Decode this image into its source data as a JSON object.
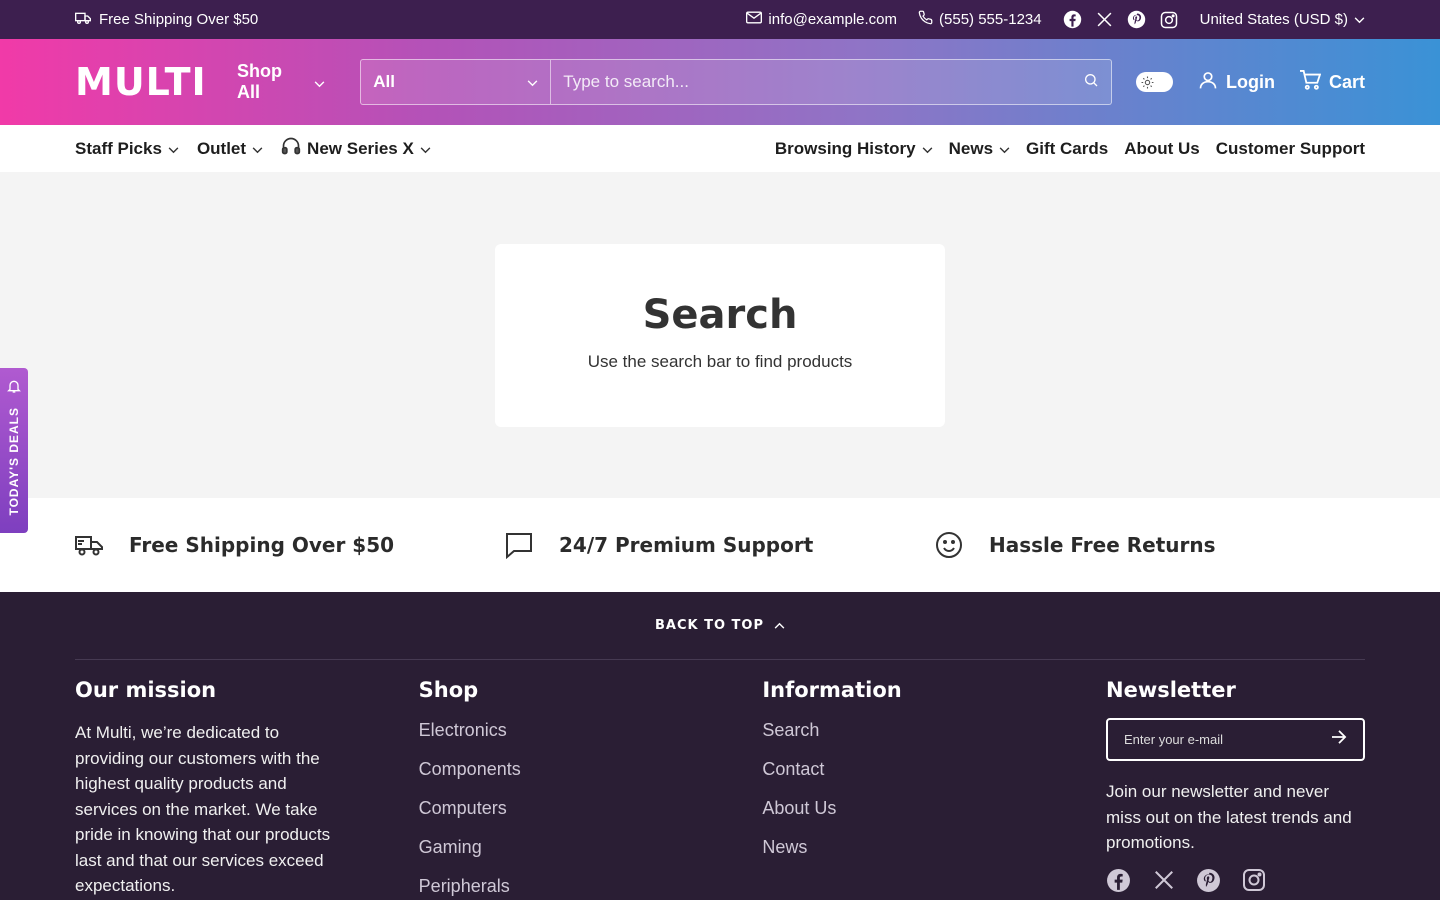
{
  "topbar": {
    "shipping": "Free Shipping Over $50",
    "email": "info@example.com",
    "phone": "(555) 555-1234",
    "socials": [
      "facebook-icon",
      "x-icon",
      "pinterest-icon",
      "instagram-icon"
    ],
    "currency": "United States (USD $)"
  },
  "header": {
    "logo": "MULTI",
    "shop_all": "Shop All",
    "search_category": "All",
    "search_placeholder": "Type to search...",
    "login": "Login",
    "cart": "Cart"
  },
  "nav": {
    "left": [
      {
        "label": "Staff Picks"
      },
      {
        "label": "Outlet"
      },
      {
        "label": "New Series X"
      }
    ],
    "right": [
      {
        "label": "Browsing History"
      },
      {
        "label": "News"
      },
      {
        "label": "Gift Cards"
      },
      {
        "label": "About Us"
      },
      {
        "label": "Customer Support"
      }
    ]
  },
  "main": {
    "title": "Search",
    "subtitle": "Use the search bar to find products"
  },
  "deals_tab": "TODAY'S DEALS",
  "features": [
    {
      "label": "Free Shipping Over $50",
      "icon": "truck-icon"
    },
    {
      "label": "24/7 Premium Support",
      "icon": "chat-icon"
    },
    {
      "label": "Hassle Free Returns",
      "icon": "smile-icon"
    }
  ],
  "footer": {
    "back_to_top": "BACK TO TOP",
    "mission_title": "Our mission",
    "mission_text": "At Multi, we’re dedicated to providing our customers with the highest quality products and services on the market. We take pride in knowing that our products last and that our services exceed expectations.",
    "shop_title": "Shop",
    "shop_links": [
      "Electronics",
      "Components",
      "Computers",
      "Gaming",
      "Peripherals"
    ],
    "info_title": "Information",
    "info_links": [
      "Search",
      "Contact",
      "About Us",
      "News"
    ],
    "newsletter_title": "Newsletter",
    "newsletter_placeholder": "Enter your e-mail",
    "newsletter_text": "Join our newsletter and never miss out on the latest trends and promotions."
  },
  "colors": {
    "topbar_bg": "#3d1f4f",
    "header_gradient_start": "#f13aa8",
    "header_gradient_end": "#3a92d6",
    "footer_bg": "#2a1e34",
    "deals_tab": "#8e45c6"
  }
}
